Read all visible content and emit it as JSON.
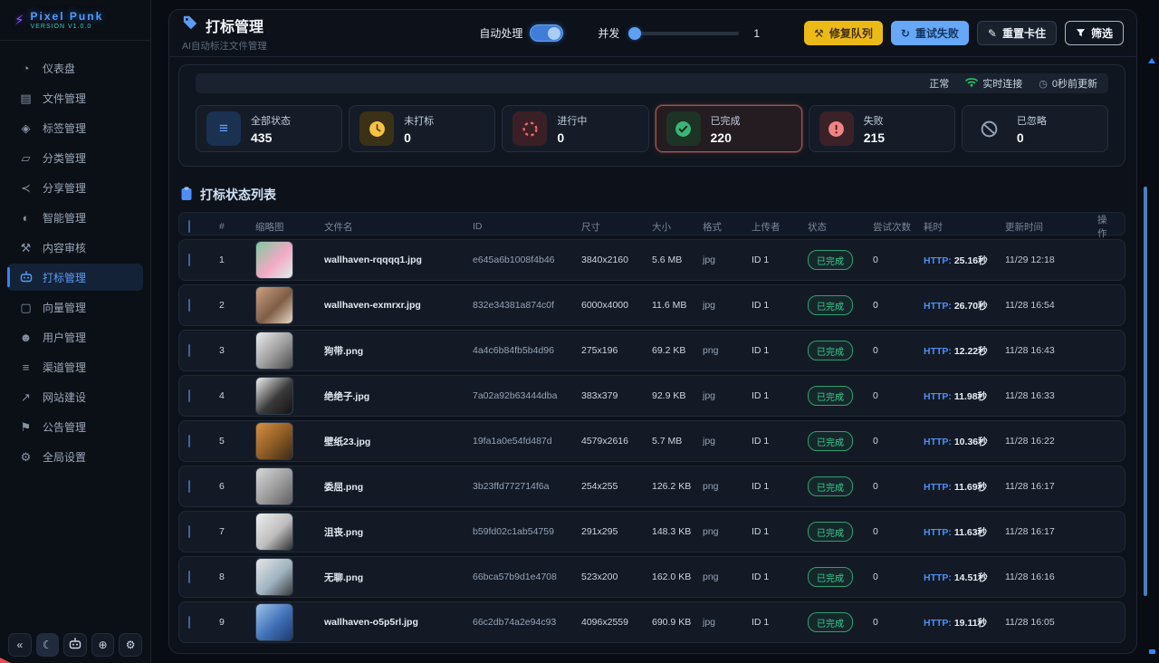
{
  "app": {
    "logo_text": "Pixel Punk",
    "version": "VERSION V1.0.0"
  },
  "colors": {
    "accent": "#3b82f6",
    "success": "#35d08e",
    "warning": "#ecba16",
    "danger": "#ef6a6a",
    "selected_card_border": "#a85454"
  },
  "sidebar": {
    "items": [
      {
        "icon": "dashboard-icon",
        "label": "仪表盘"
      },
      {
        "icon": "files-icon",
        "label": "文件管理"
      },
      {
        "icon": "tags-icon",
        "label": "标签管理"
      },
      {
        "icon": "categories-icon",
        "label": "分类管理"
      },
      {
        "icon": "share-icon",
        "label": "分享管理"
      },
      {
        "icon": "ai-icon",
        "label": "智能管理"
      },
      {
        "icon": "review-icon",
        "label": "内容审核"
      },
      {
        "icon": "robot-icon",
        "label": "打标管理",
        "active": true
      },
      {
        "icon": "vector-icon",
        "label": "向量管理"
      },
      {
        "icon": "users-icon",
        "label": "用户管理"
      },
      {
        "icon": "channels-icon",
        "label": "渠道管理"
      },
      {
        "icon": "website-icon",
        "label": "网站建设"
      },
      {
        "icon": "announcement-icon",
        "label": "公告管理"
      },
      {
        "icon": "settings-icon",
        "label": "全局设置"
      }
    ],
    "footer_icons": [
      "collapse-icon",
      "moon-icon",
      "robot-icon",
      "globe-icon",
      "gear-icon"
    ]
  },
  "header": {
    "title": "打标管理",
    "subtitle": "AI自动标注文件管理",
    "auto_process_label": "自动处理",
    "auto_process_on": true,
    "concurrency_label": "并发",
    "concurrency_value": "1",
    "buttons": [
      {
        "label": "修复队列",
        "style": "warning",
        "icon": "wrench-icon"
      },
      {
        "label": "重试失败",
        "style": "primary",
        "icon": "refresh-icon"
      },
      {
        "label": "重置卡住",
        "style": "dark",
        "icon": "brush-icon"
      },
      {
        "label": "筛选",
        "style": "outline",
        "icon": "filter-icon"
      }
    ]
  },
  "status_bar": {
    "state": "正常",
    "connection": "实时连接",
    "updated": "0秒前更新"
  },
  "stat_cards": [
    {
      "type": "all",
      "icon": "list-icon",
      "label": "全部状态",
      "value": "435"
    },
    {
      "type": "pending",
      "icon": "clock-icon",
      "label": "未打标",
      "value": "0"
    },
    {
      "type": "processing",
      "icon": "spinner-icon",
      "label": "进行中",
      "value": "0"
    },
    {
      "type": "done",
      "icon": "check-circle-icon",
      "label": "已完成",
      "value": "220",
      "selected": true
    },
    {
      "type": "failed",
      "icon": "error-circle-icon",
      "label": "失败",
      "value": "215"
    },
    {
      "type": "ignored",
      "icon": "slash-circle-icon",
      "label": "已忽略",
      "value": "0"
    }
  ],
  "table": {
    "section_title": "打标状态列表",
    "columns": [
      "#",
      "缩略图",
      "文件名",
      "ID",
      "尺寸",
      "大小",
      "格式",
      "上传者",
      "状态",
      "尝试次数",
      "耗时",
      "更新时间",
      "操作"
    ],
    "rows": [
      {
        "index": "1",
        "filename": "wallhaven-rqqqq1.jpg",
        "id": "e645a6b1008f4b46",
        "dimensions": "3840x2160",
        "size": "5.6 MB",
        "format": "jpg",
        "uploader": "ID 1",
        "status": "已完成",
        "attempts": "0",
        "time_prefix": "HTTP:",
        "time": "25.16秒",
        "updated": "11/29 12:18",
        "thumb": [
          "#7fc9a0",
          "#f2a9c4",
          "#dff0e8"
        ]
      },
      {
        "index": "2",
        "filename": "wallhaven-exmrxr.jpg",
        "id": "832e34381a874c0f",
        "dimensions": "6000x4000",
        "size": "11.6 MB",
        "format": "jpg",
        "uploader": "ID 1",
        "status": "已完成",
        "attempts": "0",
        "time_prefix": "HTTP:",
        "time": "26.70秒",
        "updated": "11/28 16:54",
        "thumb": [
          "#caa184",
          "#7e5d46",
          "#e9d9c9"
        ]
      },
      {
        "index": "3",
        "filename": "狗带.png",
        "id": "4a4c6b84fb5b4d96",
        "dimensions": "275x196",
        "size": "69.2 KB",
        "format": "png",
        "uploader": "ID 1",
        "status": "已完成",
        "attempts": "0",
        "time_prefix": "HTTP:",
        "time": "12.22秒",
        "updated": "11/28 16:43",
        "thumb": [
          "#ececec",
          "#9c9c9c",
          "#4a4a4a"
        ]
      },
      {
        "index": "4",
        "filename": "绝绝子.jpg",
        "id": "7a02a92b63444dba",
        "dimensions": "383x379",
        "size": "92.9 KB",
        "format": "jpg",
        "uploader": "ID 1",
        "status": "已完成",
        "attempts": "0",
        "time_prefix": "HTTP:",
        "time": "11.98秒",
        "updated": "11/28 16:33",
        "thumb": [
          "#f0f0f0",
          "#3a3a3a",
          "#131313"
        ]
      },
      {
        "index": "5",
        "filename": "壁纸23.jpg",
        "id": "19fa1a0e54fd487d",
        "dimensions": "4579x2616",
        "size": "5.7 MB",
        "format": "jpg",
        "uploader": "ID 1",
        "status": "已完成",
        "attempts": "0",
        "time_prefix": "HTTP:",
        "time": "10.36秒",
        "updated": "11/28 16:22",
        "thumb": [
          "#d98f3e",
          "#8a5a25",
          "#3a2a18"
        ]
      },
      {
        "index": "6",
        "filename": "委屈.png",
        "id": "3b23ffd772714f6a",
        "dimensions": "254x255",
        "size": "126.2 KB",
        "format": "png",
        "uploader": "ID 1",
        "status": "已完成",
        "attempts": "0",
        "time_prefix": "HTTP:",
        "time": "11.69秒",
        "updated": "11/28 16:17",
        "thumb": [
          "#d8d8d8",
          "#9a9a9a",
          "#5f5f5f"
        ]
      },
      {
        "index": "7",
        "filename": "沮丧.png",
        "id": "b59fd02c1ab54759",
        "dimensions": "291x295",
        "size": "148.3 KB",
        "format": "png",
        "uploader": "ID 1",
        "status": "已完成",
        "attempts": "0",
        "time_prefix": "HTTP:",
        "time": "11.63秒",
        "updated": "11/28 16:17",
        "thumb": [
          "#efefef",
          "#bdbdbd",
          "#2e2e2e"
        ]
      },
      {
        "index": "8",
        "filename": "无聊.png",
        "id": "66bca57b9d1e4708",
        "dimensions": "523x200",
        "size": "162.0 KB",
        "format": "png",
        "uploader": "ID 1",
        "status": "已完成",
        "attempts": "0",
        "time_prefix": "HTTP:",
        "time": "14.51秒",
        "updated": "11/28 16:16",
        "thumb": [
          "#e6e6e6",
          "#9fb3c0",
          "#3b3b3b"
        ]
      },
      {
        "index": "9",
        "filename": "wallhaven-o5p5rl.jpg",
        "id": "66c2db74a2e94c93",
        "dimensions": "4096x2559",
        "size": "690.9 KB",
        "format": "jpg",
        "uploader": "ID 1",
        "status": "已完成",
        "attempts": "0",
        "time_prefix": "HTTP:",
        "time": "19.11秒",
        "updated": "11/28 16:05",
        "thumb": [
          "#9fc3ea",
          "#3f6fb5",
          "#1e3a6e"
        ]
      }
    ]
  }
}
